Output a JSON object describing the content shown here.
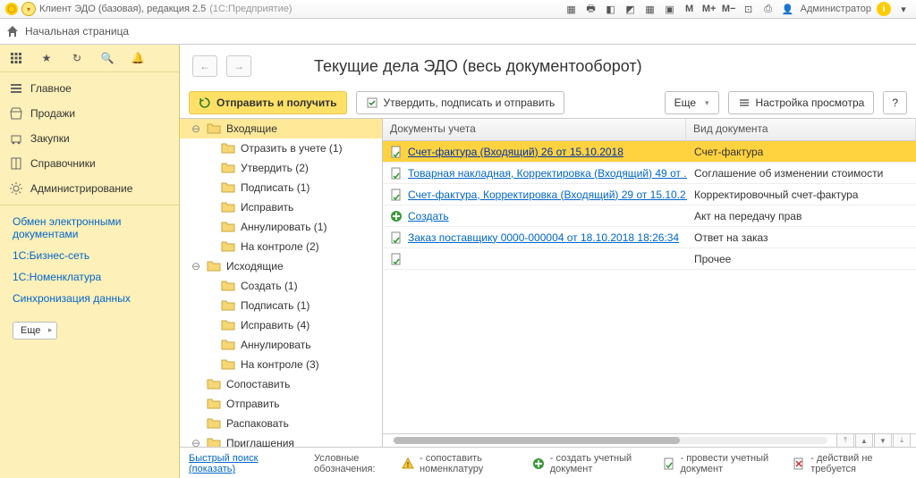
{
  "titlebar": {
    "app_name": "Клиент ЭДО (базовая), редакция 2.5",
    "platform": "(1С:Предприятие)",
    "user_label": "Администратор",
    "zoom_buttons": [
      "M",
      "M+",
      "M−"
    ]
  },
  "start_page": "Начальная страница",
  "sidebar": {
    "nav": [
      {
        "label": "Главное",
        "icon": "menu"
      },
      {
        "label": "Продажи",
        "icon": "shop"
      },
      {
        "label": "Закупки",
        "icon": "cart"
      },
      {
        "label": "Справочники",
        "icon": "book"
      },
      {
        "label": "Администрирование",
        "icon": "gear"
      }
    ],
    "sub": [
      "Обмен электронными документами",
      "1С:Бизнес-сеть",
      "1С:Номенклатура",
      "Синхронизация данных"
    ],
    "more": "Еще"
  },
  "page": {
    "title": "Текущие дела ЭДО (весь документооборот)",
    "btn_send": "Отправить и получить",
    "btn_approve": "Утвердить, подписать и отправить",
    "btn_more": "Еще",
    "btn_settings": "Настройка просмотра",
    "btn_help": "?"
  },
  "tree": [
    {
      "label": "Входящие",
      "level": 0,
      "exp": "⊖",
      "lead": true
    },
    {
      "label": "Отразить в учете (1)",
      "level": 1
    },
    {
      "label": "Утвердить (2)",
      "level": 1
    },
    {
      "label": "Подписать (1)",
      "level": 1
    },
    {
      "label": "Исправить",
      "level": 1
    },
    {
      "label": "Аннулировать (1)",
      "level": 1
    },
    {
      "label": "На контроле (2)",
      "level": 1
    },
    {
      "label": "Исходящие",
      "level": 0,
      "exp": "⊖"
    },
    {
      "label": "Создать (1)",
      "level": 1
    },
    {
      "label": "Подписать (1)",
      "level": 1
    },
    {
      "label": "Исправить (4)",
      "level": 1
    },
    {
      "label": "Аннулировать",
      "level": 1
    },
    {
      "label": "На контроле (3)",
      "level": 1
    },
    {
      "label": "Сопоставить",
      "level": 0,
      "ind": "ind1"
    },
    {
      "label": "Отправить",
      "level": 0,
      "ind": "ind1"
    },
    {
      "label": "Распаковать",
      "level": 0,
      "ind": "ind1"
    },
    {
      "label": "Приглашения",
      "level": 0,
      "exp": "⊖",
      "ind": "ind0b"
    }
  ],
  "table": {
    "col1": "Документы учета",
    "col2": "Вид документа",
    "rows": [
      {
        "doc": "Счет-фактура (Входящий) 26 от 15.10.2018",
        "type": "Счет-фактура",
        "icon": "doc-green",
        "sel": true
      },
      {
        "doc": "Товарная накладная, Корректировка (Входящий) 49 от ...",
        "type": "Соглашение об изменении стоимости",
        "icon": "doc-green"
      },
      {
        "doc": "Счет-фактура, Корректировка (Входящий) 29 от 15.10.2...",
        "type": "Корректировочный счет-фактура",
        "icon": "doc-green"
      },
      {
        "doc": "Создать",
        "type": "Акт на передачу прав",
        "icon": "plus"
      },
      {
        "doc": "Заказ поставщику 0000-000004 от 18.10.2018 18:26:34",
        "type": "Ответ на заказ",
        "icon": "doc-green"
      },
      {
        "doc": "",
        "type": "Прочее",
        "icon": "doc-green",
        "nolink": true
      }
    ]
  },
  "footer": {
    "quick": "Быстрый поиск (показать)",
    "legend_label": "Условные обозначения:",
    "legends": [
      {
        "icon": "warn",
        "text": "- сопоставить номенклатуру"
      },
      {
        "icon": "plus",
        "text": "- создать учетный документ"
      },
      {
        "icon": "doc",
        "text": "- провести учетный документ"
      },
      {
        "icon": "docx",
        "text": "- действий не требуется"
      }
    ]
  }
}
